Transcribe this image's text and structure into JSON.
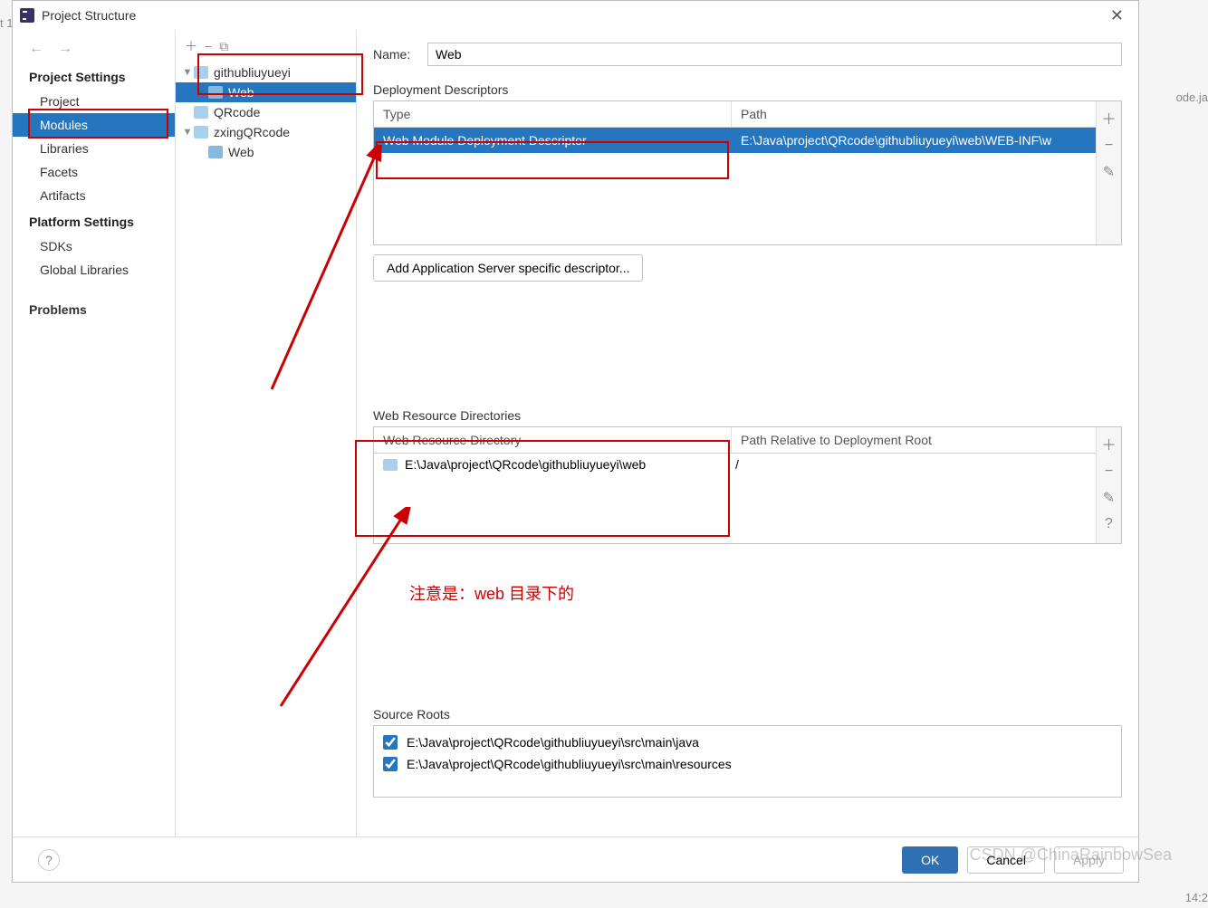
{
  "dialog": {
    "title": "Project Structure",
    "close": "✕"
  },
  "sidebar": {
    "project_settings": "Project Settings",
    "items1": [
      "Project",
      "Modules",
      "Libraries",
      "Facets",
      "Artifacts"
    ],
    "platform_settings": "Platform Settings",
    "items2": [
      "SDKs",
      "Global Libraries"
    ],
    "problems": "Problems",
    "selected": "Modules"
  },
  "tree": {
    "nodes": [
      {
        "label": "githubliuyueyi",
        "expanded": true,
        "level": 0,
        "type": "folder",
        "children": [
          {
            "label": "Web",
            "level": 1,
            "type": "web",
            "selected": true
          }
        ]
      },
      {
        "label": "QRcode",
        "level": 0,
        "type": "folder"
      },
      {
        "label": "zxingQRcode",
        "expanded": true,
        "level": 0,
        "type": "folder",
        "children": [
          {
            "label": "Web",
            "level": 1,
            "type": "web"
          }
        ]
      }
    ]
  },
  "content": {
    "name_label": "Name:",
    "name_value": "Web",
    "deploy_section": "Deployment Descriptors",
    "deploy_head": {
      "type": "Type",
      "path": "Path"
    },
    "deploy_row": {
      "type": "Web Module Deployment Descriptor",
      "path": "E:\\Java\\project\\QRcode\\githubliuyueyi\\web\\WEB-INF\\w"
    },
    "add_desc_btn": "Add Application Server specific descriptor...",
    "resource_section": "Web Resource Directories",
    "resource_head": {
      "dir": "Web Resource Directory",
      "rel": "Path Relative to Deployment Root"
    },
    "resource_row": {
      "dir": "E:\\Java\\project\\QRcode\\githubliuyueyi\\web",
      "rel": "/"
    },
    "source_section": "Source Roots",
    "source_roots": [
      "E:\\Java\\project\\QRcode\\githubliuyueyi\\src\\main\\java",
      "E:\\Java\\project\\QRcode\\githubliuyueyi\\src\\main\\resources"
    ]
  },
  "footer": {
    "ok": "OK",
    "cancel": "Cancel",
    "apply": "Apply"
  },
  "annotation": {
    "text": "注意是：web 目录下的"
  },
  "watermark": "CSDN @ChinaRainbowSea",
  "bg": {
    "left": "t 1",
    "right": "ode.ja",
    "time": "14:2"
  }
}
